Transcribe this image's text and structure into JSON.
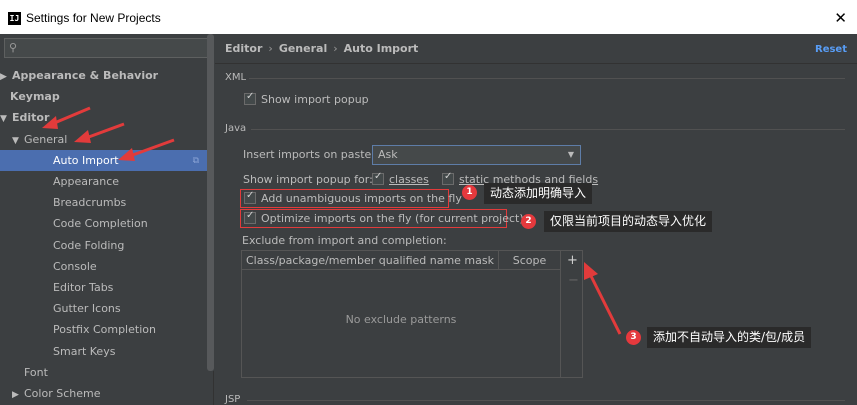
{
  "window": {
    "title": "Settings for New Projects",
    "app_icon": "IJ"
  },
  "search": {
    "placeholder": ""
  },
  "tree": [
    {
      "label": "Appearance & Behavior",
      "arrow": "▶",
      "bold": true,
      "level": 0
    },
    {
      "label": "Keymap",
      "arrow": "",
      "bold": true,
      "level": 0
    },
    {
      "label": "Editor",
      "arrow": "▼",
      "bold": true,
      "level": 0
    },
    {
      "label": "General",
      "arrow": "▼",
      "bold": false,
      "level": 1
    },
    {
      "label": "Auto Import",
      "arrow": "",
      "bold": false,
      "level": 2,
      "selected": true
    },
    {
      "label": "Appearance",
      "arrow": "",
      "bold": false,
      "level": 2
    },
    {
      "label": "Breadcrumbs",
      "arrow": "",
      "bold": false,
      "level": 2
    },
    {
      "label": "Code Completion",
      "arrow": "",
      "bold": false,
      "level": 2
    },
    {
      "label": "Code Folding",
      "arrow": "",
      "bold": false,
      "level": 2
    },
    {
      "label": "Console",
      "arrow": "",
      "bold": false,
      "level": 2
    },
    {
      "label": "Editor Tabs",
      "arrow": "",
      "bold": false,
      "level": 2
    },
    {
      "label": "Gutter Icons",
      "arrow": "",
      "bold": false,
      "level": 2
    },
    {
      "label": "Postfix Completion",
      "arrow": "",
      "bold": false,
      "level": 2
    },
    {
      "label": "Smart Keys",
      "arrow": "",
      "bold": false,
      "level": 2
    },
    {
      "label": "Font",
      "arrow": "",
      "bold": false,
      "level": 1
    },
    {
      "label": "Color Scheme",
      "arrow": "▶",
      "bold": false,
      "level": 1
    }
  ],
  "breadcrumb": {
    "editor": "Editor",
    "general": "General",
    "auto_import": "Auto Import",
    "sep": "›"
  },
  "reset_label": "Reset",
  "xml": {
    "label": "XML",
    "show_import_popup": "Show import popup"
  },
  "java": {
    "label": "Java",
    "insert_imports_label": "Insert imports on paste:",
    "insert_imports_value": "Ask",
    "show_popup_for_label": "Show import popup for:",
    "classes_label": "classes",
    "static_label": "static methods and fields",
    "add_unambiguous": "Add unambiguous imports on the fly",
    "optimize_imports": "Optimize imports on the fly (for current project)",
    "exclude_label": "Exclude from import and completion:",
    "col_mask": "Class/package/member qualified name mask",
    "col_scope": "Scope",
    "empty_text": "No exclude patterns",
    "plus": "+",
    "minus": "−"
  },
  "jsp": {
    "label": "JSP"
  },
  "annotations": [
    {
      "num": "1",
      "text": "动态添加明确导入"
    },
    {
      "num": "2",
      "text": "仅限当前项目的动态导入优化"
    },
    {
      "num": "3",
      "text": "添加不自动导入的类/包/成员"
    }
  ],
  "colors": {
    "accent": "#4b6eaf",
    "link": "#589df6",
    "annotation_red": "#e5393d",
    "background": "#3c3f41"
  }
}
